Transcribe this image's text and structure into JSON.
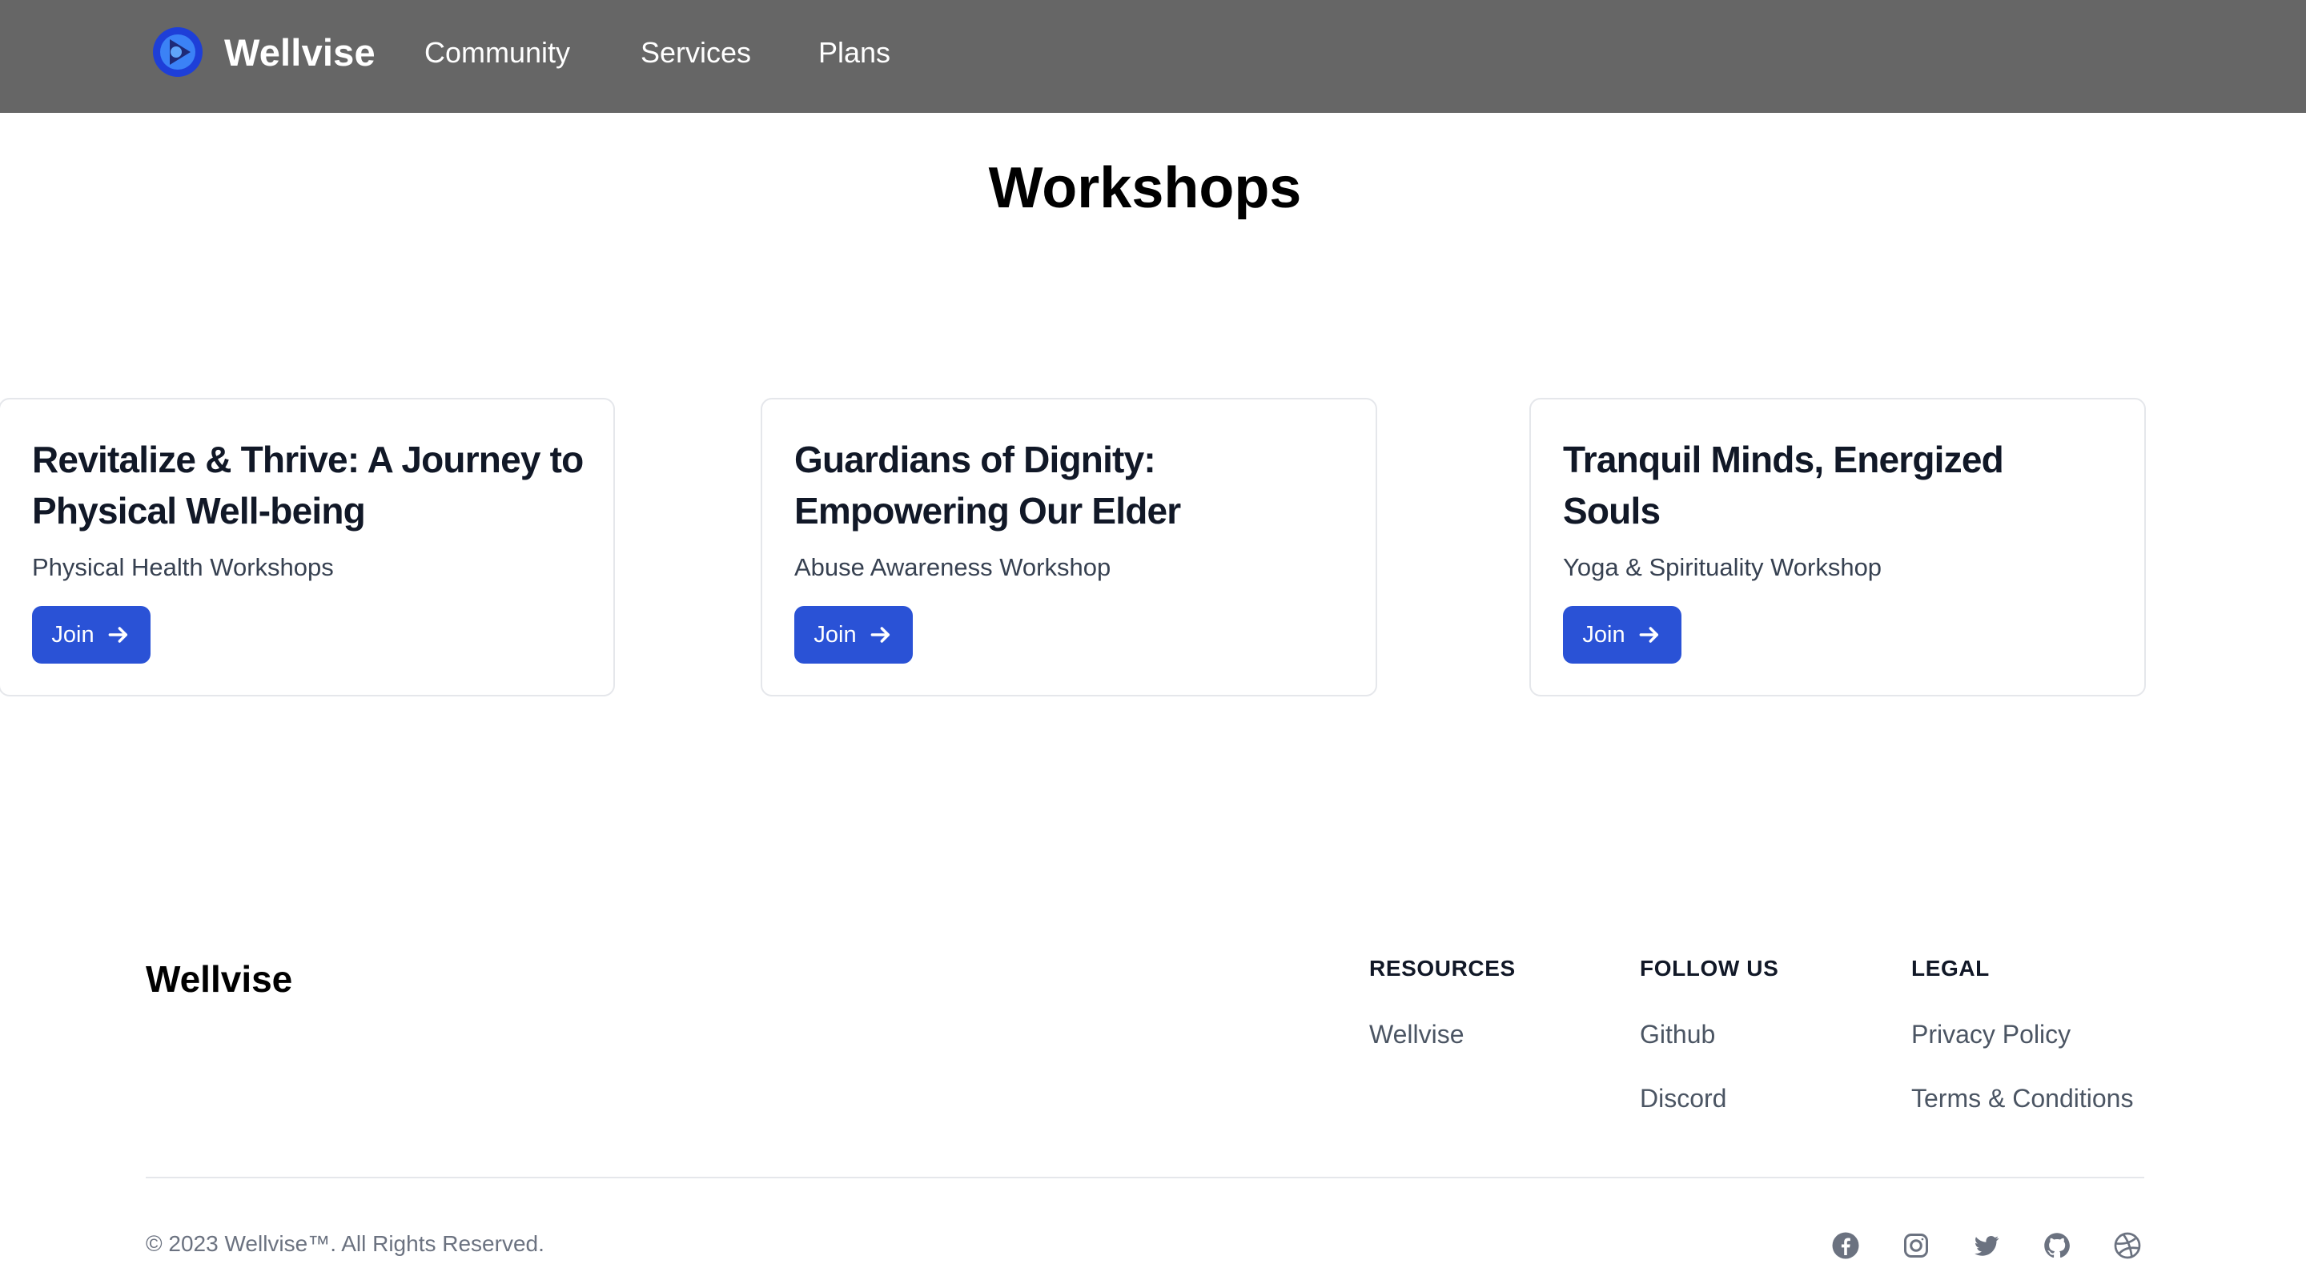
{
  "nav": {
    "brand": "Wellvise",
    "links": [
      "Community",
      "Services",
      "Plans"
    ]
  },
  "workshops": {
    "title": "Workshops",
    "cards": [
      {
        "title": "Revitalize & Thrive: A Journey to Physical Well-being",
        "subtitle": "Physical Health Workshops",
        "button": "Join"
      },
      {
        "title": "Guardians of Dignity: Empowering Our Elder",
        "subtitle": "Abuse Awareness Workshop",
        "button": "Join"
      },
      {
        "title": "Tranquil Minds, Energized Souls",
        "subtitle": "Yoga & Spirituality Workshop",
        "button": "Join"
      }
    ]
  },
  "footer": {
    "brand": "Wellvise",
    "columns": [
      {
        "heading": "RESOURCES",
        "links": [
          "Wellvise"
        ]
      },
      {
        "heading": "FOLLOW US",
        "links": [
          "Github",
          "Discord"
        ]
      },
      {
        "heading": "LEGAL",
        "links": [
          "Privacy Policy",
          "Terms & Conditions"
        ]
      }
    ],
    "copyright": "© 2023 Wellvise™. All Rights Reserved.",
    "social_icons": [
      "facebook-icon",
      "instagram-icon",
      "twitter-icon",
      "github-icon",
      "dribbble-icon"
    ]
  },
  "colors": {
    "navbar": "#666666",
    "accent": "#2a52d6",
    "card_border": "#e5e7eb",
    "muted_text": "#6b7280"
  }
}
